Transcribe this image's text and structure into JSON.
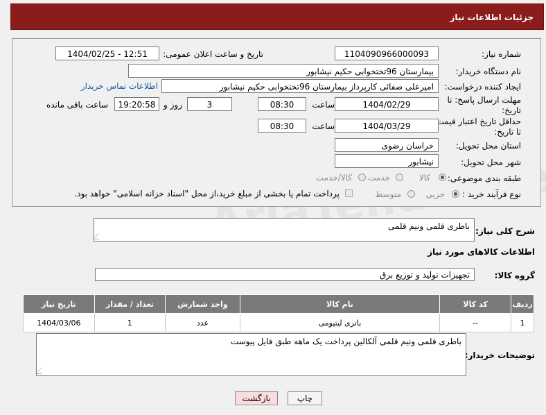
{
  "header": {
    "title": "جزئیات اطلاعات نیاز"
  },
  "form": {
    "need_number_label": "شماره نیاز:",
    "need_number": "1104090966000093",
    "announce_label": "تاریخ و ساعت اعلان عمومی:",
    "announce_value": "1404/02/25 - 12:51",
    "buyer_org_label": "نام دستگاه خریدار:",
    "buyer_org": "بیمارستان 96تختخوابی حکیم نیشابور",
    "creator_label": "ایجاد کننده درخواست:",
    "creator": "امیرعلی صفائی کارپرداز بیمارستان 96تختخوابی حکیم نیشابور",
    "contact_link": "اطلاعات تماس خریدار",
    "deadline_label_1": "مهلت ارسال پاسخ: تا",
    "deadline_label_2": "تاریخ:",
    "deadline_date": "1404/02/29",
    "time_label": "ساعت",
    "deadline_time": "08:30",
    "days_value": "3",
    "days_label": "روز و",
    "remaining_time": "19:20:58",
    "remaining_label": "ساعت باقی مانده",
    "min_validity_label_1": "حداقل تاریخ اعتبار قیمت:",
    "min_validity_label_2": "تا تاریخ:",
    "validity_date": "1404/03/29",
    "validity_time": "08:30",
    "province_label": "استان محل تحویل:",
    "province": "خراسان رضوی",
    "city_label": "شهر محل تحویل:",
    "city": "نیشابور",
    "category_label": "طبقه بندی موضوعی:",
    "category_options": [
      "کالا",
      "خدمت",
      "کالا/خدمت"
    ],
    "process_label": "نوع فرآیند خرید :",
    "process_options": [
      "جزیی",
      "متوسط"
    ],
    "payment_note": "پرداخت تمام یا بخشی از مبلغ خرید،از محل \"اسناد خزانه اسلامی\" خواهد بود."
  },
  "summary": {
    "label": "شرح کلی نیاز:",
    "value": "باطری قلمی ونیم قلمی"
  },
  "goods": {
    "section_title": "اطلاعات کالاهای مورد نیاز",
    "group_label": "گروه کالا:",
    "group_value": "تجهیزات تولید و توزیع برق",
    "columns": [
      "ردیف",
      "کد کالا",
      "نام کالا",
      "واحد شمارش",
      "تعداد / مقدار",
      "تاریخ نیاز"
    ],
    "rows": [
      [
        "1",
        "--",
        "باتری لیتیومی",
        "عدد",
        "1",
        "1404/03/06"
      ]
    ]
  },
  "notes": {
    "label": "توضیحات خریدار:",
    "value": "باطری قلمی ونیم قلمی آلکالین پرداخت یک ماهه طبق فایل پیوست"
  },
  "buttons": {
    "print": "چاپ",
    "back": "بازگشت"
  },
  "watermark": "AriaTender.net",
  "colors": {
    "header": "#8a1c1c",
    "table_header": "#7a7a7a",
    "link": "#1a5ea8",
    "back_button": "#fbdcdc"
  }
}
